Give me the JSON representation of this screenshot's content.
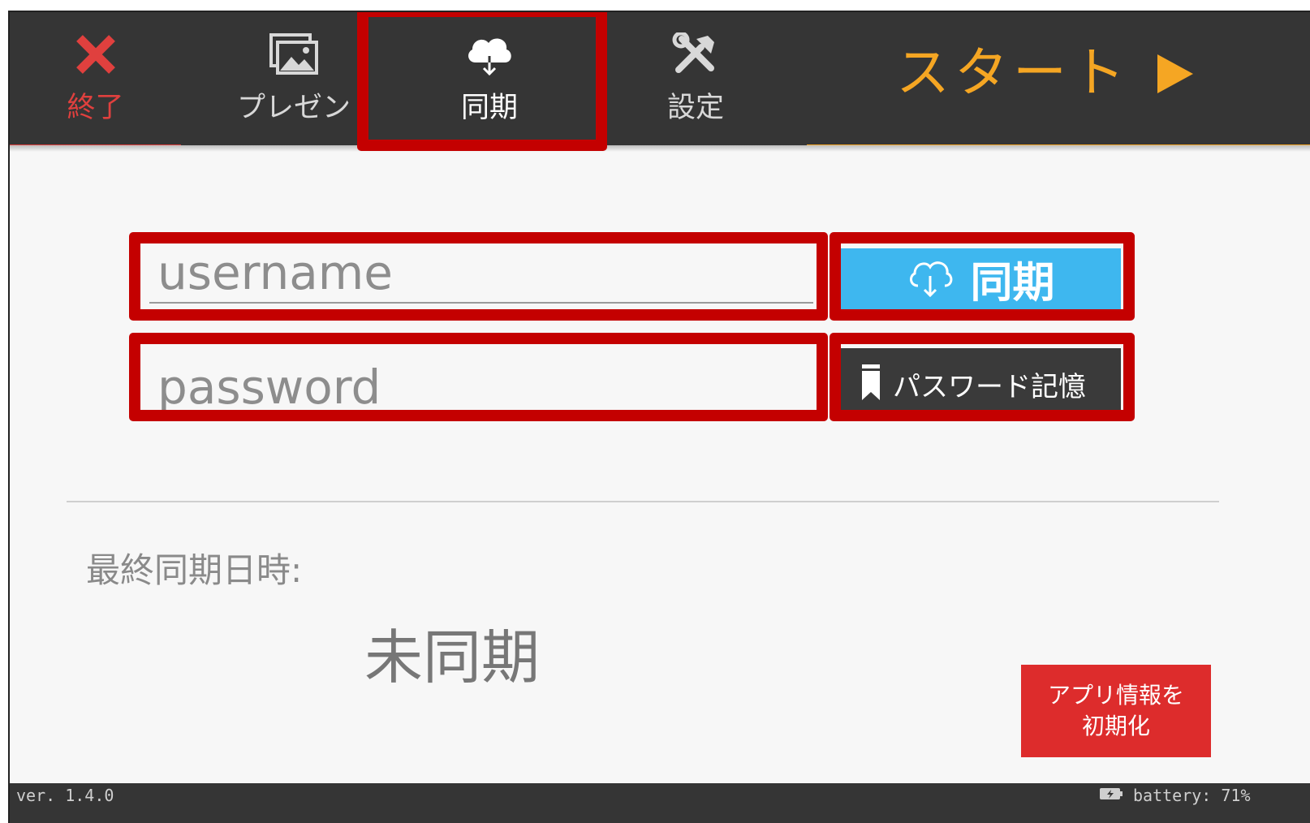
{
  "tabs": {
    "exit": {
      "label": "終了",
      "icon": "close-icon"
    },
    "present": {
      "label": "プレゼン",
      "icon": "images-icon"
    },
    "sync": {
      "label": "同期",
      "icon": "cloud-download-icon",
      "active": true
    },
    "settings": {
      "label": "設定",
      "icon": "tools-icon"
    }
  },
  "start": {
    "label": "スタート",
    "icon": "play-icon"
  },
  "form": {
    "username_placeholder": "username",
    "username_value": "",
    "password_placeholder": "password",
    "password_value": "",
    "sync_button_label": "同期",
    "remember_button_label": "パスワード記憶"
  },
  "last_sync": {
    "label": "最終同期日時:",
    "value": "未同期"
  },
  "reset_button": {
    "line1": "アプリ情報を",
    "line2": "初期化"
  },
  "status": {
    "version": "ver. 1.4.0",
    "battery": "battery: 71%"
  },
  "colors": {
    "topbar": "#353535",
    "exit_red": "#e0403e",
    "start_orange": "#f5a623",
    "sync_blue": "#3eb7ef",
    "reset_red": "#dd2c2c",
    "highlight_red": "#c40000"
  }
}
